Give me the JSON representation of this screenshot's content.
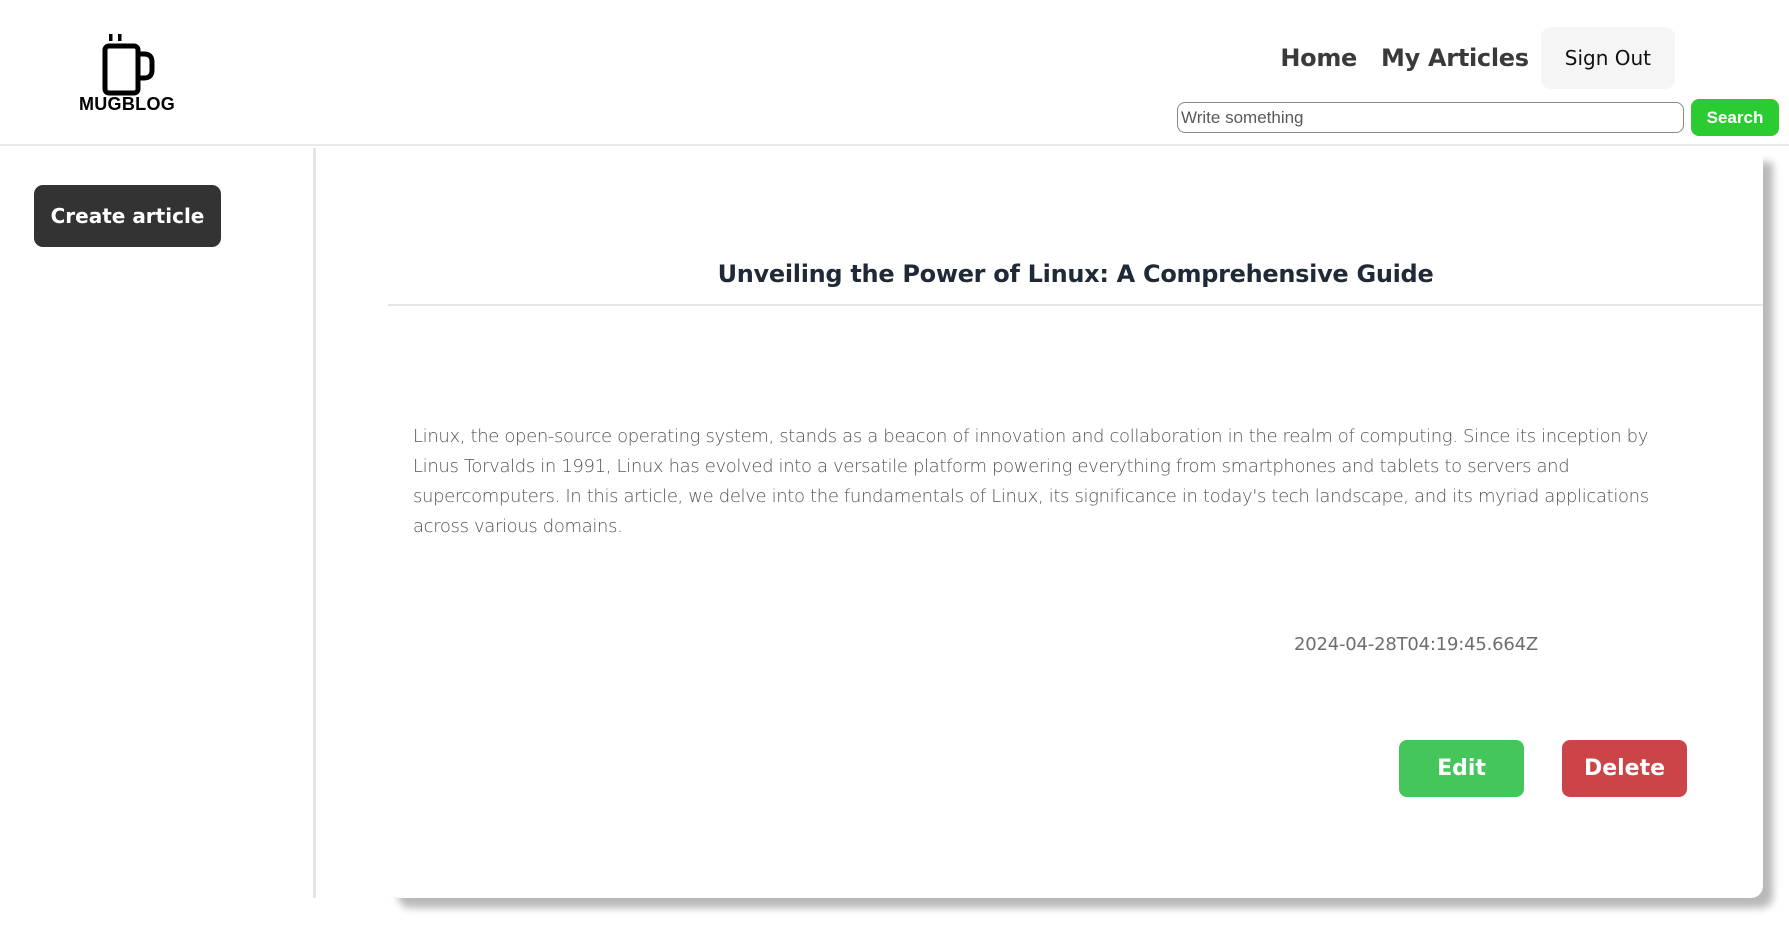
{
  "brand": {
    "name": "MUGBLOG",
    "logo_icon": "mug-icon"
  },
  "nav": {
    "home": "Home",
    "my_articles": "My Articles",
    "sign_out": "Sign Out"
  },
  "search": {
    "placeholder": "Write something",
    "value": "",
    "button": "Search"
  },
  "sidebar": {
    "create_article": "Create article"
  },
  "article": {
    "title": "Unveiling the Power of Linux: A Comprehensive Guide",
    "body": "Linux, the open-source operating system, stands as a beacon of innovation and collaboration in the realm of computing. Since its inception by Linus Torvalds in 1991, Linux has evolved into a versatile platform powering everything from smartphones and tablets to servers and supercomputers. In this article, we delve into the fundamentals of Linux, its significance in today's tech landscape, and its myriad applications across various domains.",
    "timestamp": "2024-04-28T04:19:45.664Z",
    "edit": "Edit",
    "delete": "Delete"
  },
  "colors": {
    "search_button": "#2bcc32",
    "create_button": "#333333",
    "edit_button": "#44c65a",
    "delete_button": "#cb4548"
  }
}
